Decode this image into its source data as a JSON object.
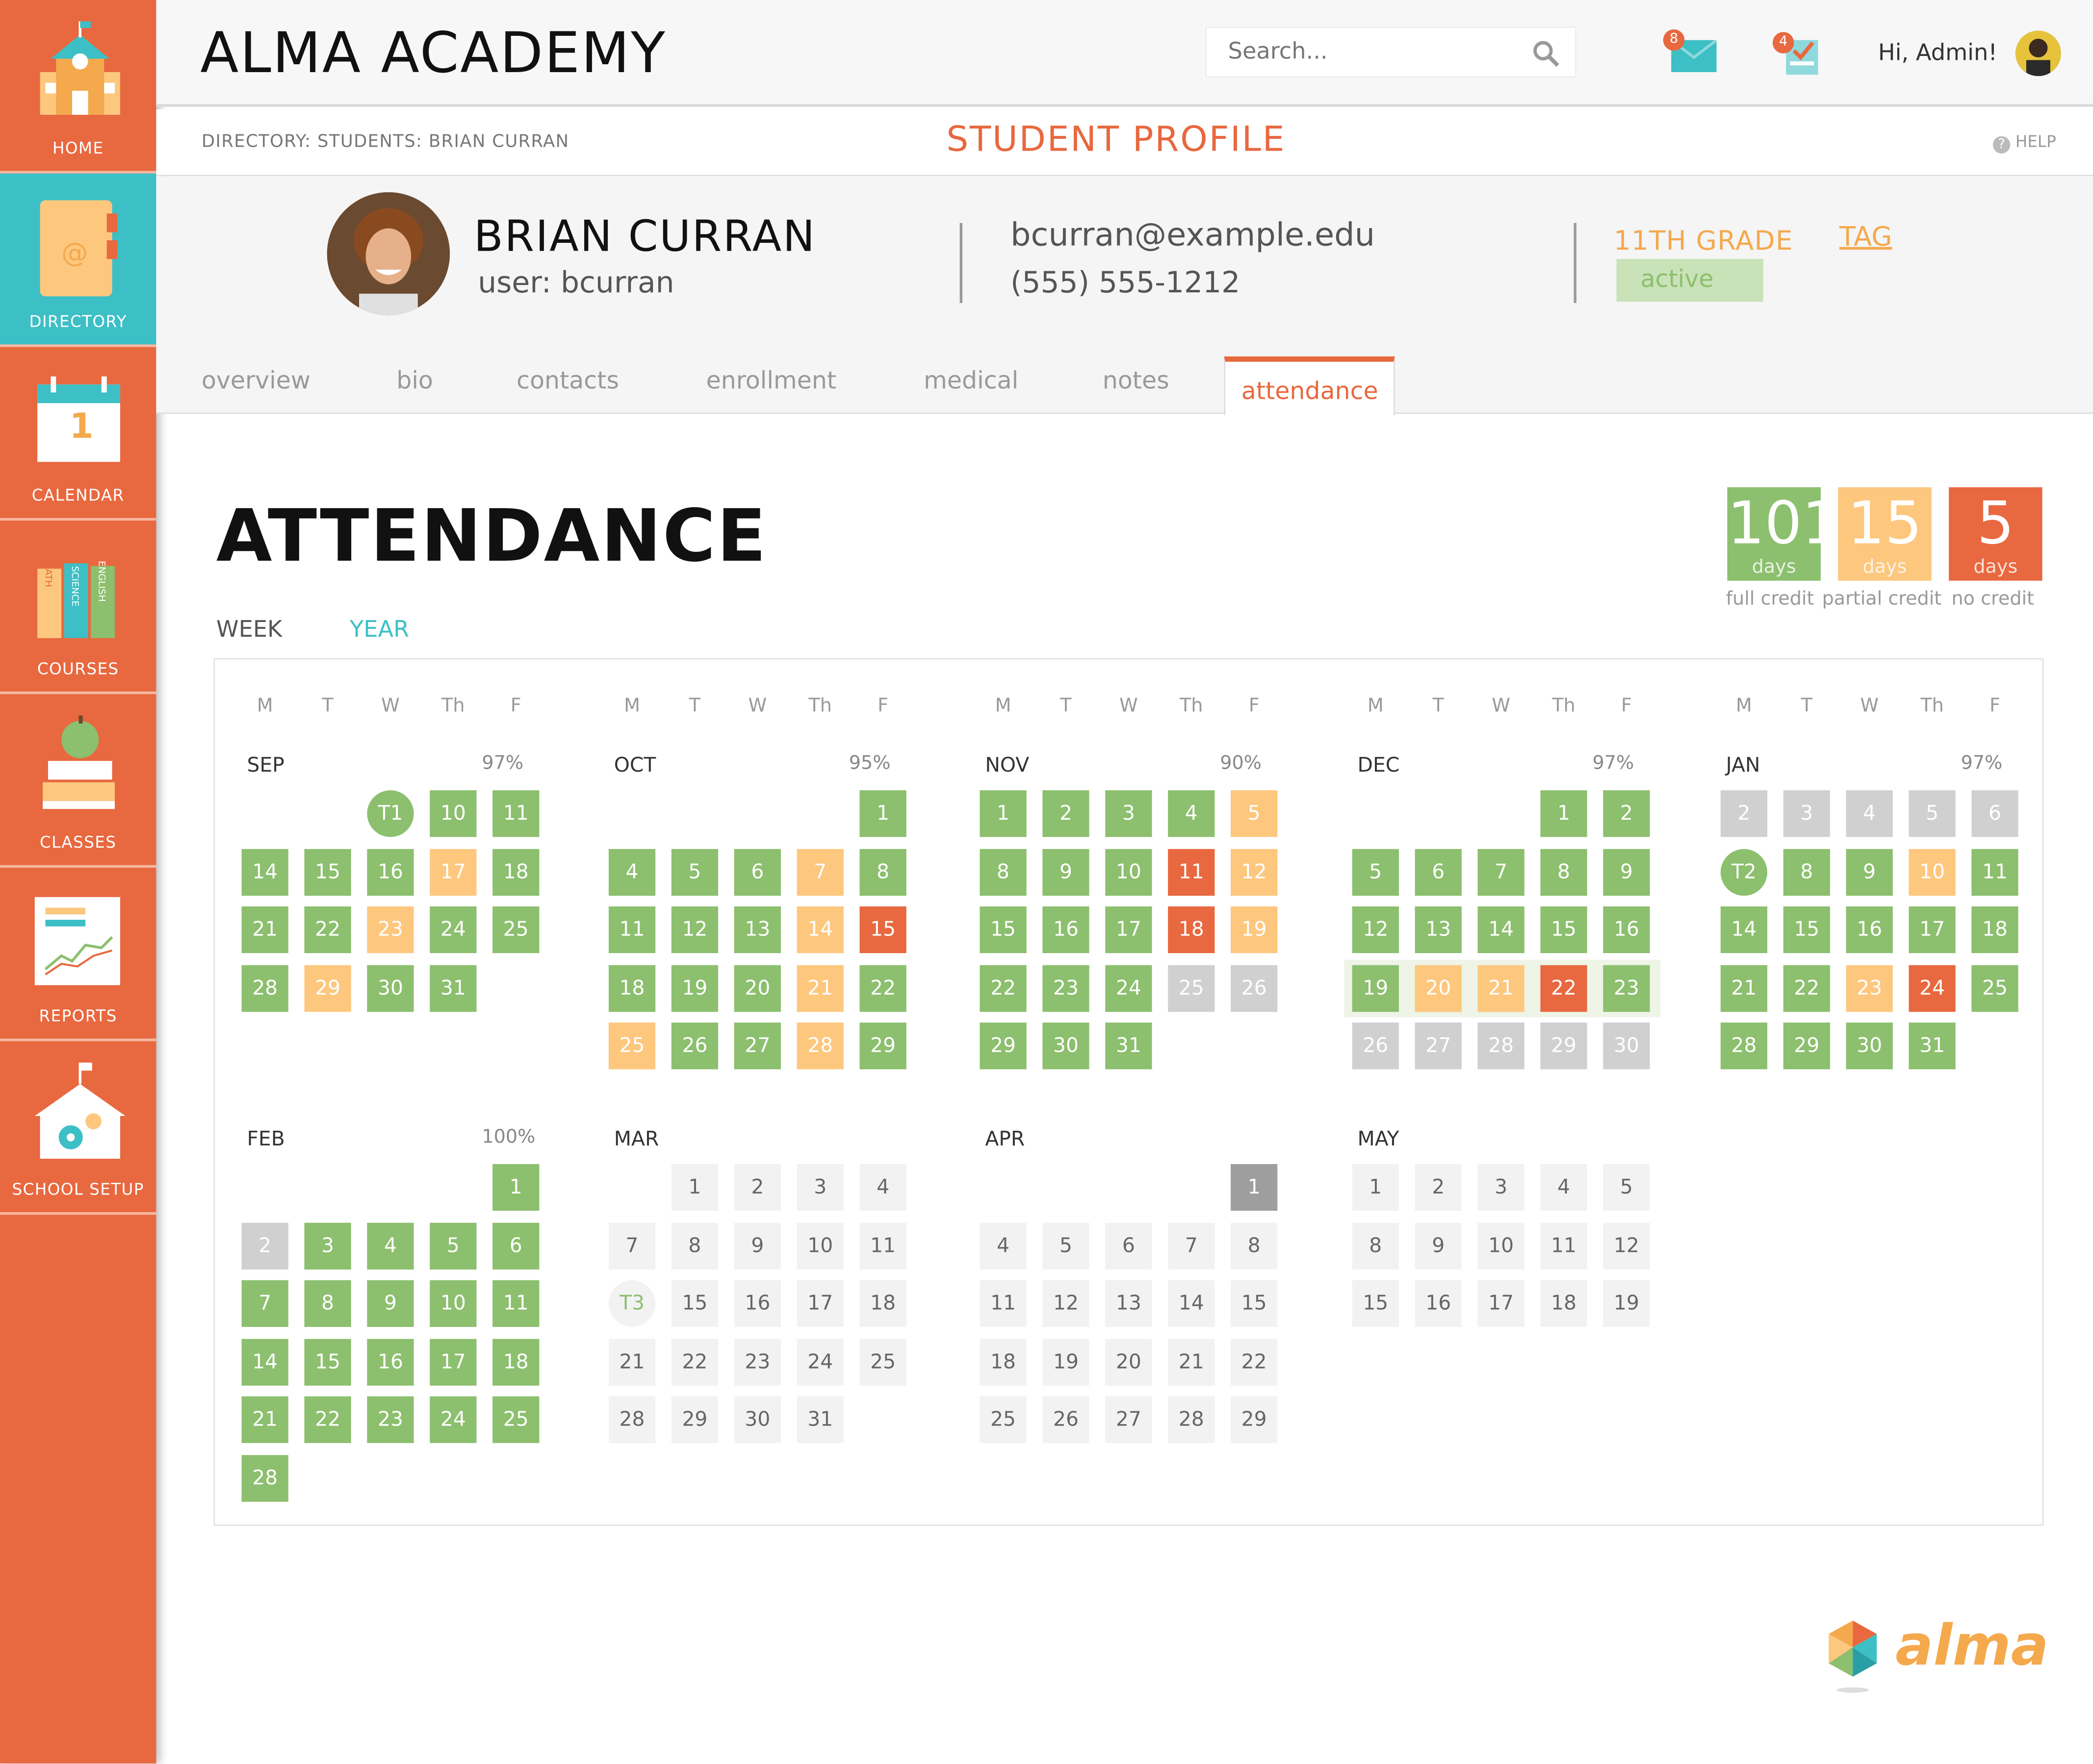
{
  "app": {
    "title": "ALMA ACADEMY",
    "logo_text": "alma"
  },
  "sidebar": {
    "items": [
      {
        "label": "HOME",
        "icon": "school-house-icon"
      },
      {
        "label": "DIRECTORY",
        "icon": "address-book-icon"
      },
      {
        "label": "CALENDAR",
        "icon": "calendar-icon",
        "icon_text": "1"
      },
      {
        "label": "COURSES",
        "icon": "books-icon",
        "book_labels": [
          "MATH",
          "SCIENCE",
          "ENGLISH"
        ]
      },
      {
        "label": "CLASSES",
        "icon": "apple-books-icon"
      },
      {
        "label": "REPORTS",
        "icon": "report-chart-icon"
      },
      {
        "label": "SCHOOL SETUP",
        "icon": "school-gear-icon"
      }
    ]
  },
  "header": {
    "search_placeholder": "Search...",
    "messages_count": "8",
    "tasks_count": "4",
    "greeting": "Hi, Admin!"
  },
  "subbar": {
    "breadcrumb": "DIRECTORY: STUDENTS: BRIAN CURRAN",
    "page_title": "STUDENT PROFILE",
    "help": "HELP"
  },
  "student": {
    "name": "BRIAN CURRAN",
    "user": "user: bcurran",
    "email": "bcurran@example.edu",
    "phone": "(555) 555-1212",
    "grade": "11TH GRADE",
    "tag": "TAG",
    "status": "active"
  },
  "tabs": [
    {
      "label": "overview",
      "active": false
    },
    {
      "label": "bio",
      "active": false
    },
    {
      "label": "contacts",
      "active": false
    },
    {
      "label": "enrollment",
      "active": false
    },
    {
      "label": "medical",
      "active": false
    },
    {
      "label": "notes",
      "active": false
    },
    {
      "label": "attendance",
      "active": true
    }
  ],
  "attendance": {
    "title": "ATTENDANCE",
    "view_toggle": {
      "week": "WEEK",
      "year": "YEAR",
      "selected": "YEAR"
    },
    "summary": [
      {
        "value": "101",
        "unit": "days",
        "label": "full credit",
        "color": "#8cbf6e"
      },
      {
        "value": "15",
        "unit": "days",
        "label": "partial credit",
        "color": "#fdc77e"
      },
      {
        "value": "5",
        "unit": "days",
        "label": "no credit",
        "color": "#e8683f"
      }
    ],
    "weekday_headers": [
      "M",
      "T",
      "W",
      "Th",
      "F"
    ],
    "legend_colors": {
      "full": "#8cbf6e",
      "partial": "#fdc77e",
      "none": "#e8683f",
      "no_school": "#d0d0d0",
      "today": "#9e9e9e",
      "future": "#f2f2f2"
    },
    "months": [
      {
        "name": "SEP",
        "pct": "97%",
        "weeks": [
          [
            null,
            null,
            "T1:gt",
            "10:g",
            "11:g"
          ],
          [
            "14:g",
            "15:g",
            "16:g",
            "17:o",
            "18:g"
          ],
          [
            "21:g",
            "22:g",
            "23:o",
            "24:g",
            "25:g"
          ],
          [
            "28:g",
            "29:o",
            "30:g",
            "31:g",
            null
          ]
        ]
      },
      {
        "name": "OCT",
        "pct": "95%",
        "weeks": [
          [
            null,
            null,
            null,
            null,
            "1:g"
          ],
          [
            "4:g",
            "5:g",
            "6:g",
            "7:o",
            "8:g"
          ],
          [
            "11:g",
            "12:g",
            "13:g",
            "14:o",
            "15:r"
          ],
          [
            "18:g",
            "19:g",
            "20:g",
            "21:o",
            "22:g"
          ],
          [
            "25:o",
            "26:g",
            "27:g",
            "28:o",
            "29:g"
          ]
        ]
      },
      {
        "name": "NOV",
        "pct": "90%",
        "weeks": [
          [
            "1:g",
            "2:g",
            "3:g",
            "4:g",
            "5:o"
          ],
          [
            "8:g",
            "9:g",
            "10:g",
            "11:r",
            "12:o"
          ],
          [
            "15:g",
            "16:g",
            "17:g",
            "18:r",
            "19:o"
          ],
          [
            "22:g",
            "23:g",
            "24:g",
            "25:x",
            "26:x"
          ],
          [
            "29:g",
            "30:g",
            "31:g",
            null,
            null
          ]
        ]
      },
      {
        "name": "DEC",
        "pct": "97%",
        "weeks": [
          [
            null,
            null,
            null,
            "1:g",
            "2:g"
          ],
          [
            "5:g",
            "6:g",
            "7:g",
            "8:g",
            "9:g"
          ],
          [
            "12:g",
            "13:g",
            "14:g",
            "15:g",
            "16:g"
          ],
          [
            "19:g",
            "20:o",
            "21:o",
            "22:r",
            "23:g"
          ],
          [
            "26:x",
            "27:x",
            "28:x",
            "29:x",
            "30:x"
          ]
        ]
      },
      {
        "name": "JAN",
        "pct": "97%",
        "weeks": [
          [
            "2:x",
            "3:x",
            "4:x",
            "5:x",
            "6:x"
          ],
          [
            "T2:gt",
            "8:g",
            "9:g",
            "10:o",
            "11:g"
          ],
          [
            "14:g",
            "15:g",
            "16:g",
            "17:g",
            "18:g"
          ],
          [
            "21:g",
            "22:g",
            "23:o",
            "24:r",
            "25:g"
          ],
          [
            "28:g",
            "29:g",
            "30:g",
            "31:g",
            null
          ]
        ]
      },
      {
        "name": "FEB",
        "pct": "100%",
        "weeks": [
          [
            null,
            null,
            null,
            null,
            "1:g"
          ],
          [
            "2:x",
            "3:g",
            "4:g",
            "5:g",
            "6:g"
          ],
          [
            "7:g",
            "8:g",
            "9:g",
            "10:g",
            "11:g"
          ],
          [
            "14:g",
            "15:g",
            "16:g",
            "17:g",
            "18:g"
          ],
          [
            "21:g",
            "22:g",
            "23:g",
            "24:g",
            "25:g"
          ],
          [
            "28:g",
            null,
            null,
            null,
            null
          ]
        ]
      },
      {
        "name": "MAR",
        "pct": "",
        "weeks": [
          [
            null,
            "1:p",
            "2:p",
            "3:p",
            "4:p"
          ],
          [
            "7:p",
            "8:p",
            "9:p",
            "10:p",
            "11:p"
          ],
          [
            "T3:pt",
            "15:p",
            "16:p",
            "17:p",
            "18:p"
          ],
          [
            "21:p",
            "22:p",
            "23:p",
            "24:p",
            "25:p"
          ],
          [
            "28:p",
            "29:p",
            "30:p",
            "31:p",
            null
          ]
        ]
      },
      {
        "name": "APR",
        "pct": "",
        "weeks": [
          [
            null,
            null,
            null,
            null,
            "1:d"
          ],
          [
            "4:p",
            "5:p",
            "6:p",
            "7:p",
            "8:p"
          ],
          [
            "11:p",
            "12:p",
            "13:p",
            "14:p",
            "15:p"
          ],
          [
            "18:p",
            "19:p",
            "20:p",
            "21:p",
            "22:p"
          ],
          [
            "25:p",
            "26:p",
            "27:p",
            "28:p",
            "29:p"
          ]
        ]
      },
      {
        "name": "MAY",
        "pct": "",
        "weeks": [
          [
            "1:p",
            "2:p",
            "3:p",
            "4:p",
            "5:p"
          ],
          [
            "8:p",
            "9:p",
            "10:p",
            "11:p",
            "12:p"
          ],
          [
            "15:p",
            "16:p",
            "17:p",
            "18:p",
            "19:p"
          ]
        ]
      }
    ]
  }
}
